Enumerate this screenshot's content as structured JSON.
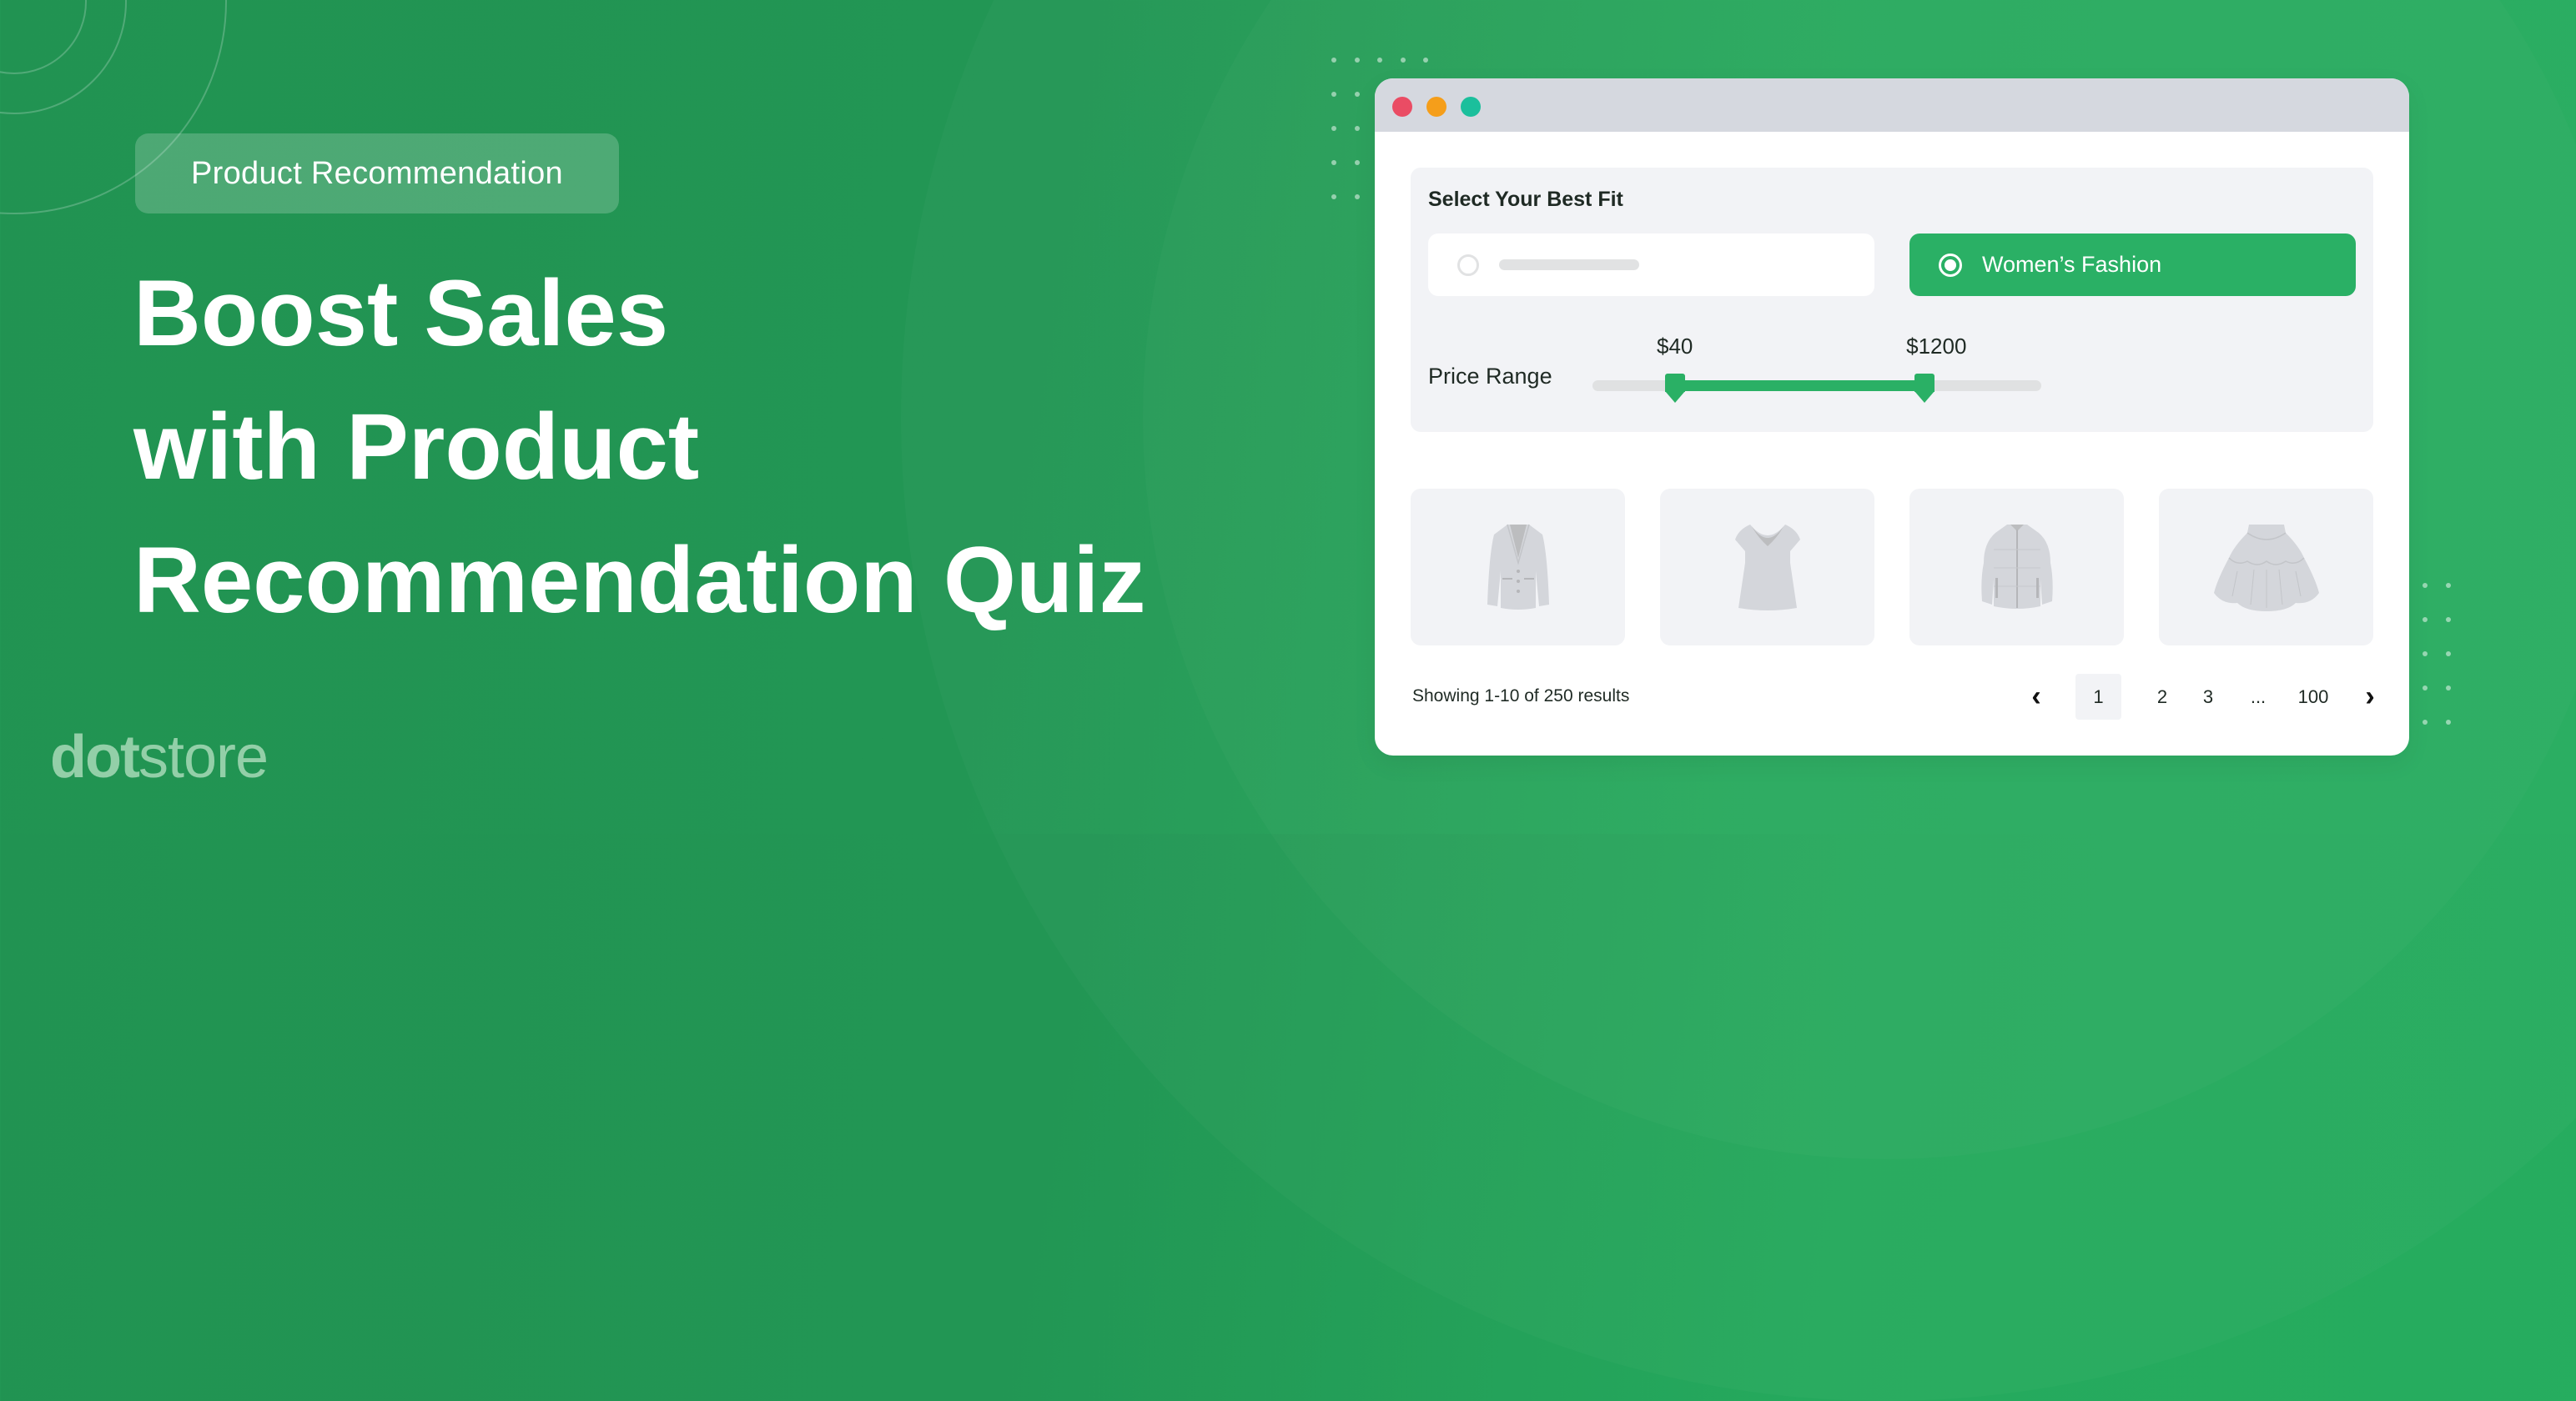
{
  "badge": {
    "label": "Product Recommendation"
  },
  "headline": {
    "lines": [
      "Boost Sales",
      "with Product",
      "Recommendation Quiz"
    ]
  },
  "logo": {
    "bold": "dot",
    "light": "store"
  },
  "colors": {
    "brand_green": "#2ab065",
    "background_green": "#229654",
    "traffic_red": "#ea4c64",
    "traffic_orange": "#f59e1a",
    "traffic_teal": "#1bbf9c"
  },
  "window": {
    "traffic_lights": [
      "close",
      "minimize",
      "maximize"
    ],
    "quiz": {
      "title": "Select Your Best Fit",
      "options": [
        {
          "label": "",
          "selected": false,
          "placeholder": true
        },
        {
          "label": "Women’s Fashion",
          "selected": true
        }
      ],
      "price_range": {
        "label": "Price Range",
        "min_label": "$40",
        "max_label": "$1200",
        "min_fraction": 0.184,
        "max_fraction": 0.74
      }
    },
    "products": [
      {
        "icon": "blazer-icon"
      },
      {
        "icon": "blouse-icon"
      },
      {
        "icon": "puffer-jacket-icon"
      },
      {
        "icon": "tiered-skirt-icon"
      }
    ],
    "results_text": "Showing 1-10 of 250 results",
    "pagination": {
      "prev": "‹",
      "pages": [
        "1",
        "2",
        "3",
        "...",
        "100"
      ],
      "active": "1",
      "next": "›"
    }
  }
}
